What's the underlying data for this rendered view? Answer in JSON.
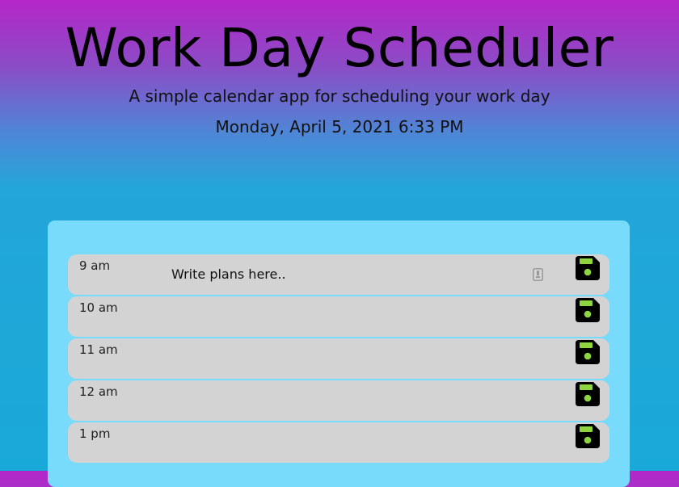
{
  "header": {
    "title": "Work Day Scheduler",
    "subtitle": "A simple calendar app for scheduling your work day",
    "datetime": "Monday, April 5, 2021 6:33 PM"
  },
  "colors": {
    "gradient_top": "#b526c9",
    "gradient_bottom": "#19a9d8",
    "panel": "#79dbfb",
    "row": "#d3d3d3",
    "save_icon": "#000000",
    "save_accent": "#8ed63f"
  },
  "rows": [
    {
      "hour": "9 am",
      "placeholder": "Write plans here..",
      "icon": "floppy-disk-icon"
    },
    {
      "hour": "10 am",
      "placeholder": "",
      "icon": "floppy-disk-icon"
    },
    {
      "hour": "11 am",
      "placeholder": "",
      "icon": "floppy-disk-icon"
    },
    {
      "hour": "12 am",
      "placeholder": "",
      "icon": "floppy-disk-icon"
    },
    {
      "hour": "1 pm",
      "placeholder": "",
      "icon": "floppy-disk-icon"
    }
  ]
}
